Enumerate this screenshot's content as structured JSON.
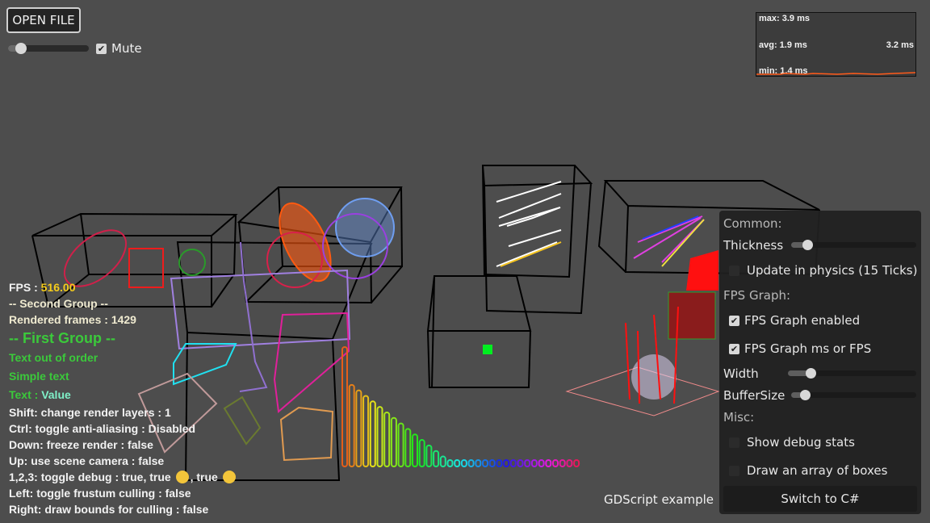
{
  "toolbar": {
    "open_file_label": "OPEN FILE",
    "volume_value": 0.16,
    "mute_label": "Mute",
    "mute_checked": true
  },
  "fps_graph": {
    "max": "max: 3.9 ms",
    "avg": "avg: 1.9 ms",
    "min": "min: 1.4 ms",
    "current": "3.2 ms",
    "line_color": "#ff5a1a"
  },
  "overlay": {
    "fps_label": "FPS : ",
    "fps_value": "516.00",
    "second_group": "-- Second Group --",
    "rendered_frames": "Rendered frames : 1429",
    "first_group": "-- First Group --",
    "text_out_of_order": "Text out of order",
    "simple_text": "Simple text",
    "text_label": "Text : ",
    "text_value": "Value",
    "hints": [
      "Shift: change render layers : 1",
      "Ctrl: toggle anti-aliasing : Disabled",
      "Down: freeze render : false",
      "Up: use scene camera : false"
    ],
    "debug_prefix": "1,2,3: toggle debug : true, true ",
    "debug_mid": ", true ",
    "hints2": [
      "Left: toggle frustum culling : false",
      "Right: draw bounds for culling : false"
    ]
  },
  "panel": {
    "common": "Common:",
    "thickness": "Thickness",
    "thickness_value": 0.1,
    "update_physics": "Update in physics (15 Ticks)",
    "update_physics_checked": false,
    "fps_graph": "FPS Graph:",
    "fps_enabled": "FPS Graph enabled",
    "fps_enabled_checked": true,
    "fps_ms": "FPS Graph ms or FPS",
    "fps_ms_checked": true,
    "width": "Width",
    "width_value": 0.18,
    "buffer": "BufferSize",
    "buffer_value": 0.08,
    "misc": "Misc:",
    "debug_stats": "Show debug stats",
    "debug_stats_checked": false,
    "array_boxes": "Draw an array of boxes",
    "array_boxes_checked": false,
    "switch": "Switch to C#"
  },
  "footer": {
    "gdscript_label": "GDScript example"
  },
  "icons": {
    "check": "✔"
  }
}
